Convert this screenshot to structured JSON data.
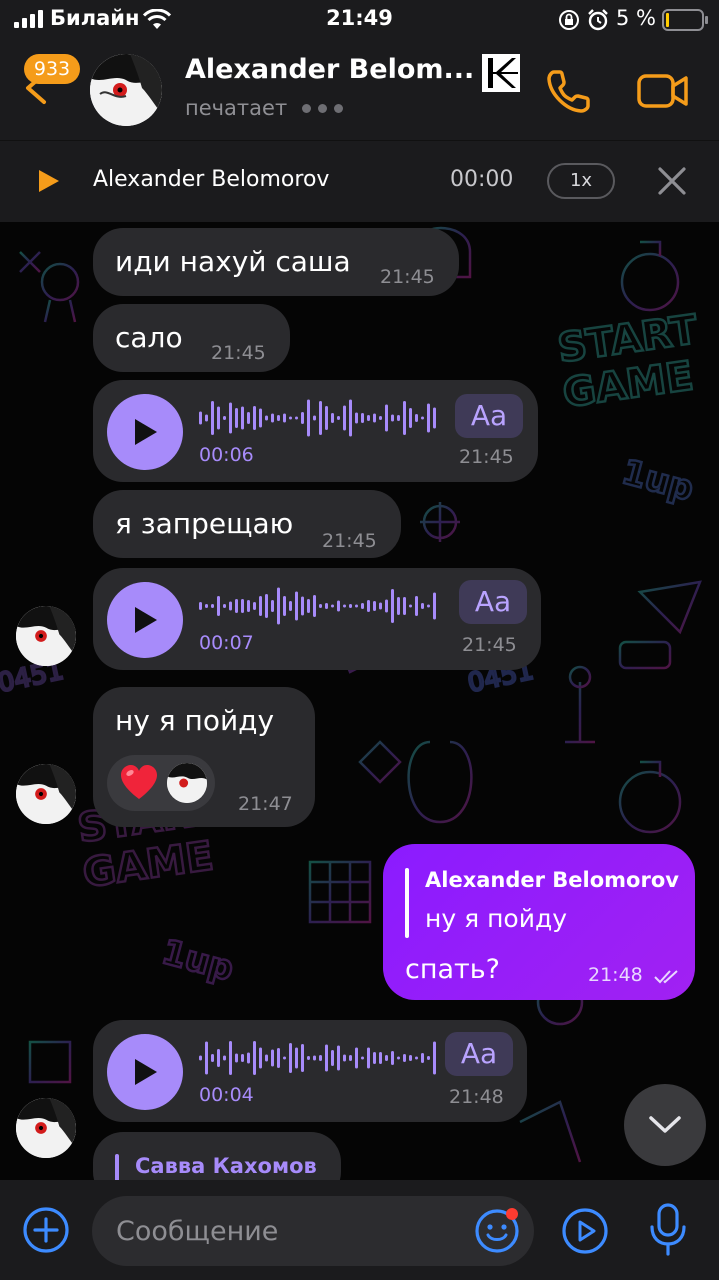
{
  "status_bar": {
    "carrier": "Билайн",
    "time": "21:49",
    "battery": "5 %"
  },
  "header": {
    "unread_badge": "933",
    "name": "Alexander Belom...",
    "status": "печатает",
    "accent": "#f59c1a"
  },
  "player": {
    "name": "Alexander Belomorov",
    "time": "00:00",
    "speed": "1x"
  },
  "messages": [
    {
      "type": "text",
      "text": "иди нахуй саша",
      "time": "21:45"
    },
    {
      "type": "text",
      "text": "сало",
      "time": "21:45"
    },
    {
      "type": "voice",
      "duration": "00:06",
      "transcribe": "Aa",
      "time": "21:45"
    },
    {
      "type": "text",
      "text": "я запрещаю",
      "time": "21:45"
    },
    {
      "type": "voice",
      "duration": "00:07",
      "transcribe": "Aa",
      "time": "21:45"
    },
    {
      "type": "text",
      "text": "ну я пойду",
      "time": "21:47",
      "reactions": [
        "heart-emoji",
        "avatar"
      ]
    },
    {
      "type": "outgoing",
      "quote_name": "Alexander Belomorov",
      "quote_text": "ну я пойду",
      "text": "спать?",
      "time": "21:48"
    },
    {
      "type": "voice",
      "duration": "00:04",
      "transcribe": "Aa",
      "time": "21:48"
    },
    {
      "type": "reply",
      "quote_name": "Савва Кахомов"
    }
  ],
  "input": {
    "placeholder": "Сообщение"
  },
  "colors": {
    "bubble": "#2a2a2d",
    "voice_accent": "#a78bfa",
    "outgoing": "#8b1bff"
  }
}
